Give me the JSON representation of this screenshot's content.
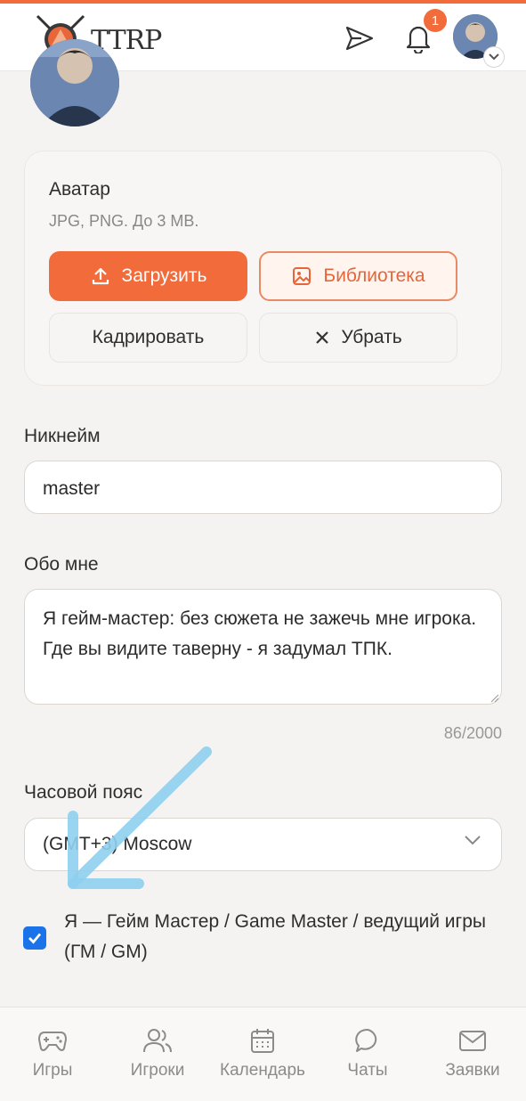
{
  "colors": {
    "accent": "#f26b3a",
    "checkbox": "#1a73e8",
    "arrow": "#8fd0f0"
  },
  "header": {
    "logo_text": "TTRP",
    "notification_count": "1",
    "icons": [
      "send-icon",
      "bell-icon",
      "avatar",
      "chevron-down-icon"
    ]
  },
  "avatar_card": {
    "title": "Аватар",
    "hint": "JPG, PNG. До 3 MB.",
    "upload_label": "Загрузить",
    "library_label": "Библиотека",
    "crop_label": "Кадрировать",
    "remove_label": "Убрать"
  },
  "nickname": {
    "label": "Никнейм",
    "value": "master"
  },
  "about": {
    "label": "Обо мне",
    "value": "Я гейм-мастер: без сюжета не зажечь мне игрока.\nГде вы видите таверну - я задумал ТПК.",
    "counter": "86/2000"
  },
  "timezone": {
    "label": "Часовой пояс",
    "value": "(GMT+3) Moscow"
  },
  "gm_checkbox": {
    "checked": true,
    "label": "Я — Гейм Мастер / Game Master / ведущий игры (ГМ / GM)"
  },
  "bottom_nav": [
    {
      "label": "Игры",
      "icon": "gamepad-icon"
    },
    {
      "label": "Игроки",
      "icon": "users-icon"
    },
    {
      "label": "Календарь",
      "icon": "calendar-icon"
    },
    {
      "label": "Чаты",
      "icon": "chat-icon"
    },
    {
      "label": "Заявки",
      "icon": "mail-icon"
    }
  ]
}
